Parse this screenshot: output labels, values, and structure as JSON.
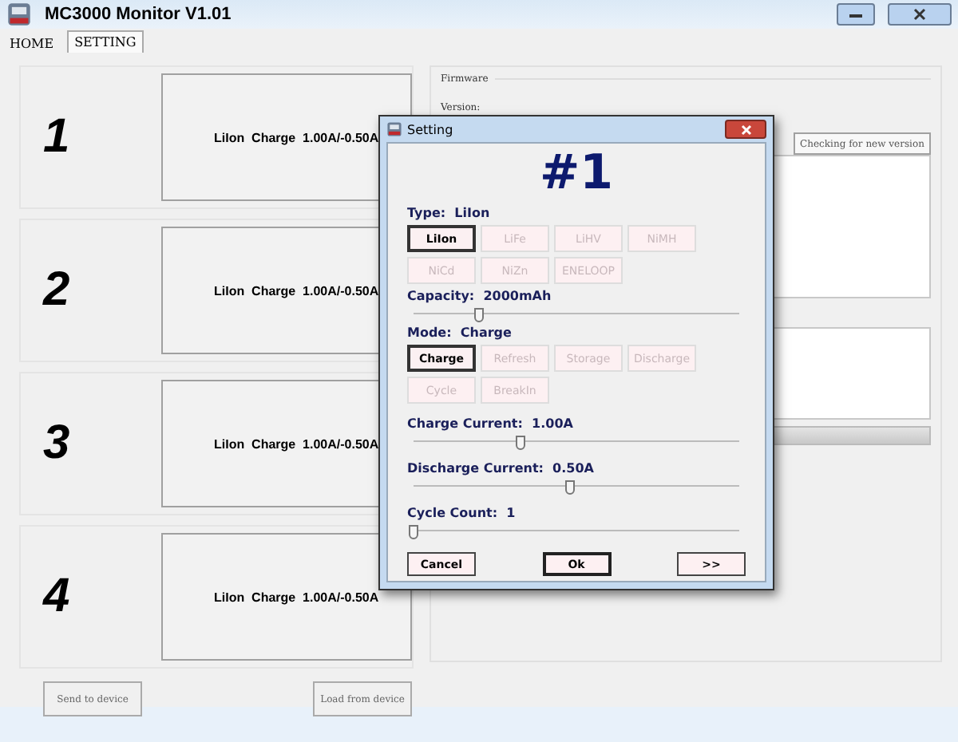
{
  "window": {
    "title": "MC3000 Monitor V1.01"
  },
  "tabs": [
    {
      "label": "HOME",
      "selected": false
    },
    {
      "label": "SETTING",
      "selected": true
    }
  ],
  "slots": [
    {
      "number": "1",
      "summary": "LiIon  Charge  1.00A/-0.50A"
    },
    {
      "number": "2",
      "summary": "LiIon  Charge  1.00A/-0.50A"
    },
    {
      "number": "3",
      "summary": "LiIon  Charge  1.00A/-0.50A"
    },
    {
      "number": "4",
      "summary": "LiIon  Charge  1.00A/-0.50A"
    }
  ],
  "firmware": {
    "heading": "Firmware",
    "version_label": "Version:",
    "check_button": "Checking for new version",
    "progress": {
      "level": 0
    }
  },
  "footer_buttons": [
    "Send to device",
    "Load from device"
  ],
  "dialog": {
    "title": "Setting",
    "slot_heading": "#1",
    "type_label": "Type:",
    "type_value": "LiIon",
    "types": [
      {
        "label": "LiIon",
        "selected": true
      },
      {
        "label": "LiFe",
        "selected": false
      },
      {
        "label": "LiHV",
        "selected": false
      },
      {
        "label": "NiMH",
        "selected": false
      },
      {
        "label": "NiCd",
        "selected": false
      },
      {
        "label": "NiZn",
        "selected": false
      },
      {
        "label": "ENELOOP",
        "selected": false
      }
    ],
    "capacity": {
      "label": "Capacity:",
      "value": "2000mAh",
      "level": 0.2
    },
    "mode_label": "Mode:",
    "mode_value": "Charge",
    "modes": [
      {
        "label": "Charge",
        "selected": true
      },
      {
        "label": "Refresh",
        "selected": false
      },
      {
        "label": "Storage",
        "selected": false
      },
      {
        "label": "Discharge",
        "selected": false
      },
      {
        "label": "Cycle",
        "selected": false
      },
      {
        "label": "BreakIn",
        "selected": false
      }
    ],
    "sliders": [
      {
        "label": "Charge Current:",
        "value": "1.00A",
        "level": 0.33
      },
      {
        "label": "Discharge Current:",
        "value": "0.50A",
        "level": 0.48
      },
      {
        "label": "Cycle Count:",
        "value": "1",
        "level": 0
      }
    ],
    "buttons": [
      "Cancel",
      "Ok",
      ">>"
    ]
  }
}
